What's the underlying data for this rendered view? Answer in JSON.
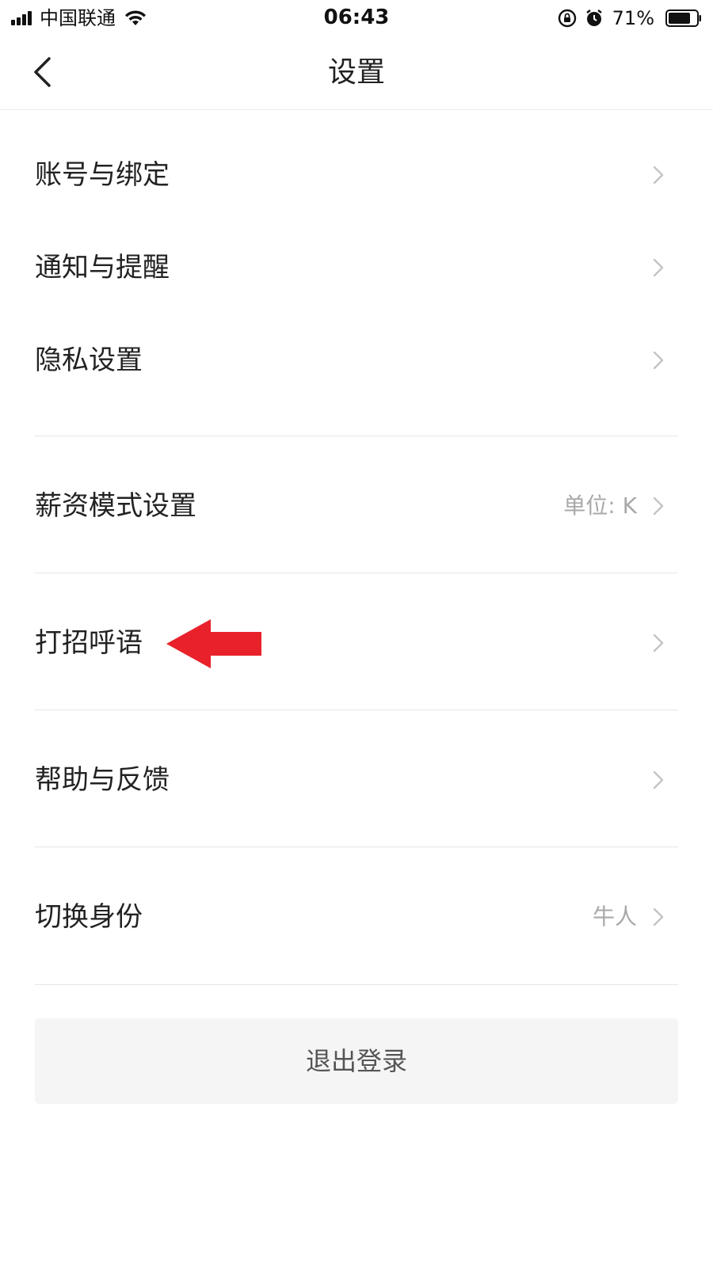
{
  "status_bar": {
    "carrier": "中国联通",
    "time": "06:43",
    "battery": "71%"
  },
  "nav": {
    "title": "设置"
  },
  "items": [
    {
      "label": "账号与绑定",
      "value": ""
    },
    {
      "label": "通知与提醒",
      "value": ""
    },
    {
      "label": "隐私设置",
      "value": ""
    },
    {
      "label": "薪资模式设置",
      "value": "单位: K"
    },
    {
      "label": "打招呼语",
      "value": ""
    },
    {
      "label": "帮助与反馈",
      "value": ""
    },
    {
      "label": "切换身份",
      "value": "牛人"
    }
  ],
  "logout_label": "退出登录",
  "colors": {
    "annotation_arrow": "#e8212b",
    "logout_bg": "#f5f5f5",
    "secondary_text": "#a8a8a8"
  }
}
